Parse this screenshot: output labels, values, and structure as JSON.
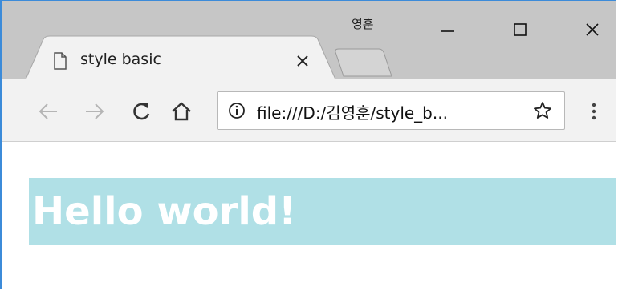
{
  "window": {
    "profile_name": "영훈",
    "frame_color": "#3c8bd9",
    "controls": [
      "minimize-icon",
      "maximize-icon",
      "close-icon"
    ]
  },
  "tabs": [
    {
      "title": "style basic",
      "icon": "page-icon",
      "active": true
    }
  ],
  "toolbar": {
    "nav_icons": [
      "back-arrow-icon",
      "forward-arrow-icon",
      "reload-icon",
      "home-icon"
    ],
    "address_bar": {
      "url": "file:///D:/김영훈/style_b...",
      "security_icon": "info-icon",
      "bookmark_icon": "star-icon"
    },
    "menu_icon": "kebab-menu-icon"
  },
  "page": {
    "heading": "Hello world!",
    "heading_background": "#b0e0e6",
    "heading_color": "#ffffff"
  }
}
